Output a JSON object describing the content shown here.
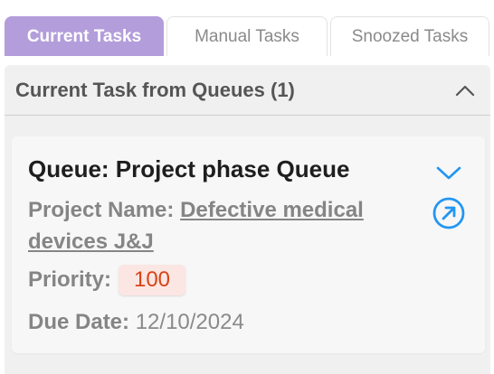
{
  "tabs": [
    {
      "label": "Current Tasks"
    },
    {
      "label": "Manual Tasks"
    },
    {
      "label": "Snoozed Tasks"
    }
  ],
  "panel": {
    "title": "Current Task from Queues (1)",
    "collapse_icon": "chevron-up-icon"
  },
  "card": {
    "title": "Queue: Project phase Queue",
    "project_label": "Project Name:",
    "project_value": "Defective medical devices J&J",
    "priority_label": "Priority:",
    "priority_value": "100",
    "due_label": "Due Date:",
    "due_value": "12/10/2024",
    "expand_icon": "chevron-down-icon",
    "open_icon": "open-in-new-icon"
  },
  "colors": {
    "active_tab": "#b39ddb",
    "icon_blue": "#2196f3",
    "badge_bg": "#fbe6e3",
    "badge_text": "#d84315"
  }
}
